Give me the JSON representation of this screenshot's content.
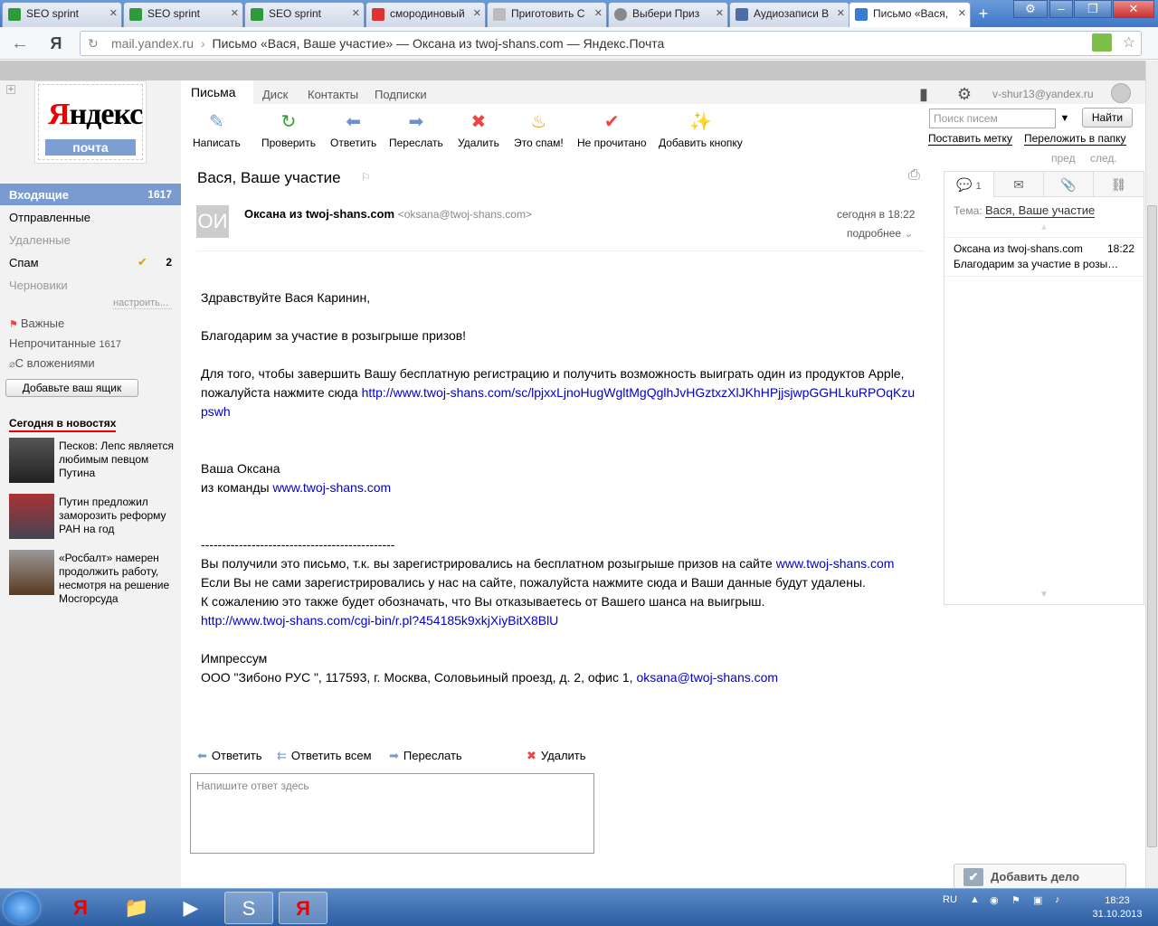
{
  "browser": {
    "tabs": [
      {
        "label": "SEO sprint",
        "icon": "seo-sprint-icon",
        "color": "#2e9a3a"
      },
      {
        "label": "SEO sprint",
        "icon": "seo-sprint-icon",
        "color": "#2e9a3a"
      },
      {
        "label": "SEO sprint",
        "icon": "seo-sprint-icon",
        "color": "#2e9a3a"
      },
      {
        "label": "смородиновый",
        "icon": "yandex-icon",
        "color": "#d33"
      },
      {
        "label": "Приготовить С",
        "icon": "page-icon",
        "color": "#999"
      },
      {
        "label": "Выбери Приз",
        "icon": "globe-icon",
        "color": "#888"
      },
      {
        "label": "Аудиозаписи В",
        "icon": "vk-icon",
        "color": "#4a6ea5"
      },
      {
        "label": "Письмо «Вася,",
        "icon": "mail-icon",
        "color": "#3a7bd5"
      }
    ],
    "yandex_btn": "Я",
    "url_host": "mail.yandex.ru",
    "url_sep": "›",
    "url_title": "Письмо «Вася, Ваше участие» — Оксана из twoj-shans.com — Яндекс.Почта"
  },
  "logo": {
    "brand_red": "Я",
    "brand_rest": "ндекс",
    "service": "почта"
  },
  "folders": {
    "inbox": {
      "label": "Входящие",
      "count": "1617"
    },
    "sent": {
      "label": "Отправленные"
    },
    "deleted": {
      "label": "Удаленные"
    },
    "spam": {
      "label": "Спам",
      "count": "2"
    },
    "drafts": {
      "label": "Черновики"
    },
    "configure": "настроить...",
    "important": "Важные",
    "unread": {
      "label": "Непрочитанные",
      "count": "1617"
    },
    "attachments": "С вложениями",
    "add_box": "Добавьте ваш ящик"
  },
  "news": {
    "heading": "Сегодня в новостях",
    "items": [
      "Песков: Лепс является любимым певцом Путина",
      "Путин предложил заморозить реформу РАН на год",
      "«Росбалт» намерен продолжить работу, несмотря на решение Мосгорсуда"
    ]
  },
  "topnav": {
    "letters": "Письма",
    "disk": "Диск",
    "contacts": "Контакты",
    "subscriptions": "Подписки"
  },
  "toolbar": {
    "compose": "Написать",
    "check": "Проверить",
    "reply": "Ответить",
    "forward": "Переслать",
    "delete": "Удалить",
    "spam": "Это спам!",
    "unread": "Не прочитано",
    "add_button": "Добавить кнопку"
  },
  "user": {
    "email": "v-shur13@yandex.ru"
  },
  "search": {
    "placeholder": "Поиск писем",
    "button": "Найти"
  },
  "right_links": {
    "label": "Поставить метку",
    "move": "Переложить в папку",
    "prev": "пред",
    "next": "след."
  },
  "thread": {
    "tab_count": "1",
    "topic_label": "Тема:",
    "topic": "Вася, Ваше участие",
    "item_sender": "Оксана из twoj-shans.com",
    "item_time": "18:22",
    "item_snippet": "Благодарим за участие в розы…"
  },
  "add_task": "Добавить дело",
  "message": {
    "subject": "Вася, Ваше участие",
    "avatar_initials": "ОИ",
    "sender_name": "Оксана из twoj-shans.com",
    "sender_email": "<oksana@twoj-shans.com>",
    "date": "сегодня в 18:22",
    "more": "подробнее",
    "greeting": "Здравствуйте Вася Каринин,",
    "thanks": "Благодарим за участие в розыгрыше призов!",
    "para1": "Для того, чтобы завершить Вашу бесплатную регистрацию и получить возможность выиграть один из продуктов Apple, пожалуйста нажмите сюда ",
    "link1": "http://www.twoj-shans.com/sc/lpjxxLjnoHugWgltMgQglhJvHGztxzXlJKhHPjjsjwpGGHLkuRPOqKzupswh",
    "sign1": "Ваша Оксана",
    "sign2": "из команды ",
    "site_link": "www.twoj-shans.com",
    "separator": "----------------------------------------------",
    "note1": "Вы получили это письмо, т.к. вы зарегистрировались на бесплатном розыгрыше призов на сайте ",
    "note_link": "www.twoj-shans.com",
    "note2": "Если Вы не сами зарегистрировались у нас на сайте, пожалуйста нажмите сюда и Ваши данные будут удалены.",
    "note3": "К сожалению это также  будет обозначать, что Вы отказываетесь от Вашего шанса на выигрыш.",
    "link2": "http://www.twoj-shans.com/cgi-bin/r.pl?454185k9xkjXiyBitX8BlU",
    "impressum": "Импрессум",
    "address": "ООО \"Зибоно РУС \", 117593, г. Москва, Соловьиный проезд, д. 2, офис 1, ",
    "email_link": "oksana@twoj-shans.com"
  },
  "actions": {
    "reply": "Ответить",
    "reply_all": "Ответить всем",
    "forward": "Переслать",
    "delete": "Удалить"
  },
  "reply_box": {
    "placeholder": "Напишите ответ здесь"
  },
  "taskbar": {
    "lang": "RU",
    "time": "18:23",
    "date": "31.10.2013"
  }
}
